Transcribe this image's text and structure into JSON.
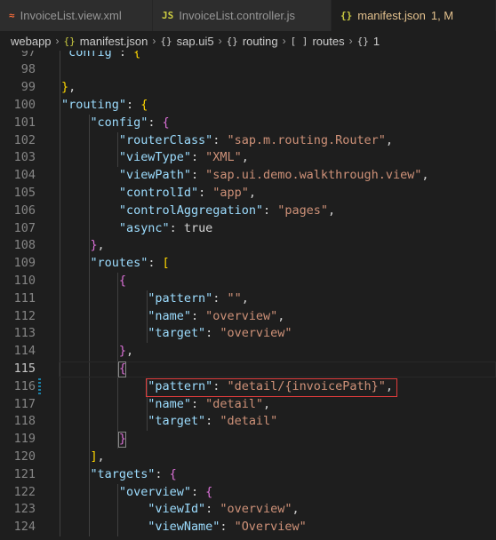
{
  "tabs": [
    {
      "icon": "rss-icon",
      "icon_glyph": "≈",
      "label": "InvoiceList.view.xml",
      "active": false
    },
    {
      "icon": "js-file-icon",
      "icon_glyph": "JS",
      "label": "InvoiceList.controller.js",
      "active": false
    },
    {
      "icon": "json-file-icon",
      "icon_glyph": "{}",
      "label": "manifest.json",
      "status": "1, M",
      "active": true
    }
  ],
  "breadcrumb": [
    {
      "label": "webapp",
      "sym": ""
    },
    {
      "label": "manifest.json",
      "sym": "{}"
    },
    {
      "label": "sap.ui5",
      "sym": "{}"
    },
    {
      "label": "routing",
      "sym": "{}"
    },
    {
      "label": "routes",
      "sym": "[ ]"
    },
    {
      "label": "1",
      "sym": "{}"
    }
  ],
  "editor": {
    "current_line": "115",
    "lines": [
      {
        "n": "97",
        "text": "        \"config\": {"
      },
      {
        "n": "98",
        "text": ""
      },
      {
        "n": "99",
        "text": "        },"
      },
      {
        "n": "100",
        "text": "        \"routing\": {"
      },
      {
        "n": "101",
        "text": "            \"config\": {"
      },
      {
        "n": "102",
        "text": "                \"routerClass\": \"sap.m.routing.Router\","
      },
      {
        "n": "103",
        "text": "                \"viewType\": \"XML\","
      },
      {
        "n": "104",
        "text": "                \"viewPath\": \"sap.ui.demo.walkthrough.view\","
      },
      {
        "n": "105",
        "text": "                \"controlId\": \"app\","
      },
      {
        "n": "106",
        "text": "                \"controlAggregation\": \"pages\","
      },
      {
        "n": "107",
        "text": "                \"async\": true"
      },
      {
        "n": "108",
        "text": "            },"
      },
      {
        "n": "109",
        "text": "            \"routes\": ["
      },
      {
        "n": "110",
        "text": "                {"
      },
      {
        "n": "111",
        "text": "                    \"pattern\": \"\","
      },
      {
        "n": "112",
        "text": "                    \"name\": \"overview\","
      },
      {
        "n": "113",
        "text": "                    \"target\": \"overview\""
      },
      {
        "n": "114",
        "text": "                },"
      },
      {
        "n": "115",
        "text": "                {"
      },
      {
        "n": "116",
        "text": "                    \"pattern\": \"detail/{invoicePath}\","
      },
      {
        "n": "117",
        "text": "                    \"name\": \"detail\","
      },
      {
        "n": "118",
        "text": "                    \"target\": \"detail\""
      },
      {
        "n": "119",
        "text": "                }"
      },
      {
        "n": "120",
        "text": "            ],"
      },
      {
        "n": "121",
        "text": "            \"targets\": {"
      },
      {
        "n": "122",
        "text": "                \"overview\": {"
      },
      {
        "n": "123",
        "text": "                    \"viewId\": \"overview\","
      },
      {
        "n": "124",
        "text": "                    \"viewName\": \"Overview\""
      }
    ]
  },
  "colors": {
    "key": "#9cdcfe",
    "string": "#ce9178",
    "boolean": "#569cd6",
    "bracket_level1": "#ffd700",
    "bracket_level2": "#da70d6",
    "highlight_box": "#e03c3c"
  }
}
